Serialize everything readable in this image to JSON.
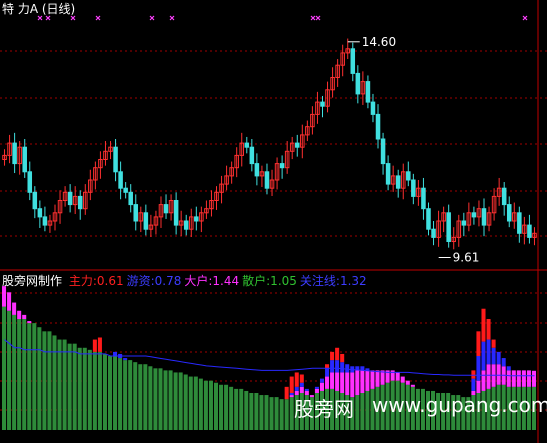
{
  "title": "特  力A (日线)",
  "indicator_bar": {
    "name": "股旁网制作",
    "items": [
      {
        "label": "主力:",
        "value": "0.61",
        "color": "#ff2020"
      },
      {
        "label": "游资:",
        "value": "0.78",
        "color": "#3c3cff"
      },
      {
        "label": "大户:",
        "value": "1.44",
        "color": "#ff30ff"
      },
      {
        "label": "散户:",
        "value": "1.05",
        "color": "#30c030"
      },
      {
        "label": "关注线:",
        "value": "1.32",
        "color": "#3c3cff"
      }
    ]
  },
  "watermark": {
    "site_cn": "股旁网",
    "site_url": "www.gupang.com"
  },
  "colors": {
    "up": "#ff3030",
    "down": "#40e0e0",
    "grid": "#a00000",
    "marker": "#ff40ff",
    "retail": "#2e8b3a",
    "bighand": "#ff30ff",
    "hotmoney": "#2828ff",
    "main": "#ff1a1a"
  },
  "chart_data": [
    {
      "type": "candlestick",
      "annotations": [
        {
          "text": "14.60",
          "kind": "high"
        },
        {
          "text": "9.61",
          "kind": "low"
        }
      ],
      "ylim": [
        9.2,
        15.2
      ],
      "closes": [
        11.8,
        12.1,
        11.6,
        12.0,
        11.4,
        10.9,
        10.5,
        10.3,
        10.1,
        10.2,
        10.4,
        10.7,
        10.9,
        10.6,
        10.8,
        10.5,
        10.9,
        11.2,
        11.5,
        11.7,
        11.9,
        12.0,
        11.4,
        11.0,
        10.9,
        10.6,
        10.2,
        10.4,
        10.0,
        10.1,
        10.3,
        10.6,
        10.4,
        10.7,
        10.1,
        10.2,
        10.0,
        10.3,
        10.2,
        10.4,
        10.5,
        10.7,
        10.9,
        11.1,
        11.3,
        11.5,
        11.8,
        12.1,
        12.0,
        11.6,
        11.3,
        11.4,
        11.0,
        11.2,
        11.6,
        11.5,
        11.9,
        12.1,
        12.0,
        12.3,
        12.5,
        12.8,
        13.1,
        13.0,
        13.4,
        13.7,
        14.0,
        14.3,
        14.4,
        13.8,
        13.3,
        13.6,
        13.1,
        12.8,
        12.2,
        11.6,
        11.1,
        11.3,
        11.0,
        11.4,
        11.2,
        10.8,
        11.0,
        10.5,
        10.0,
        9.8,
        10.2,
        10.4,
        9.7,
        9.8,
        10.2,
        10.1,
        10.4,
        10.3,
        10.5,
        10.1,
        10.4,
        10.8,
        11.0,
        10.6,
        10.2,
        10.4,
        9.9,
        10.1,
        9.8,
        9.9
      ]
    },
    {
      "type": "stacked_bar",
      "values_current": {
        "main": 0.61,
        "hotmoney": 0.78,
        "bighand": 1.44,
        "retail": 1.05,
        "watchline": 1.32
      },
      "ylim": [
        0,
        3.6
      ],
      "retail": [
        3.0,
        2.9,
        2.8,
        2.7,
        2.7,
        2.6,
        2.6,
        2.5,
        2.4,
        2.4,
        2.3,
        2.2,
        2.2,
        2.1,
        2.1,
        2.0,
        2.0,
        1.95,
        1.9,
        1.9,
        1.85,
        1.8,
        1.8,
        1.75,
        1.7,
        1.7,
        1.65,
        1.6,
        1.6,
        1.55,
        1.5,
        1.5,
        1.45,
        1.45,
        1.4,
        1.4,
        1.35,
        1.3,
        1.3,
        1.25,
        1.2,
        1.2,
        1.15,
        1.1,
        1.1,
        1.05,
        1.0,
        1.0,
        0.95,
        0.9,
        0.9,
        0.85,
        0.85,
        0.8,
        0.8,
        0.75,
        0.75,
        0.8,
        0.85,
        0.9,
        0.85,
        0.8,
        0.9,
        0.95,
        1.0,
        1.0,
        0.95,
        0.9,
        0.85,
        0.8,
        0.85,
        0.9,
        0.95,
        1.0,
        1.05,
        1.1,
        1.15,
        1.2,
        1.2,
        1.15,
        1.1,
        1.05,
        1.0,
        1.0,
        0.95,
        0.95,
        0.9,
        0.9,
        0.9,
        0.85,
        0.85,
        0.8,
        0.8,
        0.85,
        0.9,
        0.95,
        1.0,
        1.05,
        1.1,
        1.1,
        1.05,
        1.05,
        1.05,
        1.05,
        1.05,
        1.05
      ],
      "bighand": [
        0.5,
        0.45,
        0.3,
        0.2,
        0.1,
        0.05,
        0,
        0,
        0,
        0,
        0,
        0,
        0,
        0,
        0,
        0,
        0,
        0,
        0,
        0,
        0,
        0,
        0,
        0,
        0,
        0,
        0,
        0,
        0,
        0,
        0,
        0,
        0,
        0,
        0,
        0,
        0,
        0,
        0,
        0,
        0,
        0,
        0,
        0,
        0,
        0,
        0,
        0,
        0,
        0,
        0,
        0,
        0,
        0,
        0,
        0,
        0,
        0.05,
        0.1,
        0.15,
        0.1,
        0.05,
        0.1,
        0.2,
        0.3,
        0.4,
        0.45,
        0.5,
        0.55,
        0.6,
        0.6,
        0.55,
        0.5,
        0.45,
        0.4,
        0.35,
        0.3,
        0.25,
        0.2,
        0.15,
        0.1,
        0.05,
        0,
        0,
        0,
        0,
        0,
        0,
        0,
        0,
        0,
        0,
        0,
        0.1,
        0.3,
        0.5,
        0.6,
        0.55,
        0.5,
        0.45,
        0.4,
        0.4,
        0.4,
        0.4,
        0.4,
        0.39
      ],
      "hotmoney": [
        0,
        0,
        0,
        0,
        0,
        0,
        0,
        0,
        0,
        0,
        0,
        0,
        0,
        0,
        0,
        0,
        0,
        0,
        0,
        0,
        0,
        0,
        0.1,
        0.1,
        0.05,
        0,
        0,
        0,
        0,
        0,
        0,
        0,
        0,
        0,
        0,
        0,
        0,
        0,
        0,
        0,
        0,
        0,
        0,
        0,
        0,
        0,
        0,
        0,
        0,
        0,
        0,
        0,
        0,
        0,
        0,
        0,
        0,
        0.05,
        0.1,
        0.1,
        0.05,
        0,
        0.05,
        0.1,
        0.2,
        0.3,
        0.3,
        0.25,
        0.2,
        0.15,
        0.1,
        0.1,
        0.05,
        0,
        0,
        0,
        0,
        0,
        0,
        0,
        0,
        0,
        0,
        0,
        0,
        0,
        0,
        0,
        0,
        0,
        0,
        0,
        0,
        0.3,
        0.6,
        0.7,
        0.6,
        0.4,
        0.3,
        0.2,
        0.1,
        0,
        0,
        0,
        0,
        0
      ],
      "main": [
        0,
        0,
        0,
        0,
        0,
        0,
        0,
        0,
        0,
        0,
        0,
        0,
        0,
        0,
        0,
        0,
        0,
        0,
        0.3,
        0.35,
        0,
        0,
        0,
        0,
        0,
        0,
        0,
        0,
        0,
        0,
        0,
        0,
        0,
        0,
        0,
        0,
        0,
        0,
        0,
        0,
        0,
        0,
        0,
        0,
        0,
        0,
        0,
        0,
        0,
        0,
        0,
        0,
        0,
        0,
        0,
        0,
        0.3,
        0.4,
        0.35,
        0.2,
        0,
        0,
        0,
        0,
        0.1,
        0.2,
        0.3,
        0.2,
        0,
        0,
        0,
        0,
        0,
        0,
        0,
        0,
        0,
        0,
        0,
        0,
        0,
        0,
        0,
        0,
        0,
        0,
        0,
        0,
        0,
        0,
        0,
        0,
        0,
        0.2,
        0.6,
        0.8,
        0.5,
        0.2,
        0,
        0,
        0,
        0,
        0,
        0,
        0,
        0
      ],
      "watchline": [
        2.2,
        2.1,
        2.0,
        2.0,
        1.95,
        1.95,
        1.95,
        1.95,
        1.9,
        1.9,
        1.9,
        1.9,
        1.9,
        1.9,
        1.9,
        1.85,
        1.85,
        1.85,
        1.85,
        1.85,
        1.85,
        1.8,
        1.8,
        1.8,
        1.8,
        1.8,
        1.8,
        1.8,
        1.8,
        1.78,
        1.76,
        1.74,
        1.72,
        1.7,
        1.68,
        1.66,
        1.64,
        1.62,
        1.6,
        1.58,
        1.56,
        1.55,
        1.54,
        1.53,
        1.52,
        1.51,
        1.5,
        1.49,
        1.48,
        1.47,
        1.46,
        1.45,
        1.45,
        1.45,
        1.45,
        1.45,
        1.45,
        1.46,
        1.47,
        1.48,
        1.49,
        1.5,
        1.5,
        1.5,
        1.5,
        1.5,
        1.5,
        1.49,
        1.48,
        1.47,
        1.46,
        1.45,
        1.44,
        1.43,
        1.42,
        1.41,
        1.4,
        1.4,
        1.4,
        1.4,
        1.4,
        1.39,
        1.38,
        1.37,
        1.36,
        1.35,
        1.35,
        1.34,
        1.34,
        1.33,
        1.33,
        1.33,
        1.33,
        1.33,
        1.33,
        1.33,
        1.33,
        1.33,
        1.33,
        1.33,
        1.32,
        1.32,
        1.32,
        1.32,
        1.32,
        1.32
      ]
    }
  ]
}
